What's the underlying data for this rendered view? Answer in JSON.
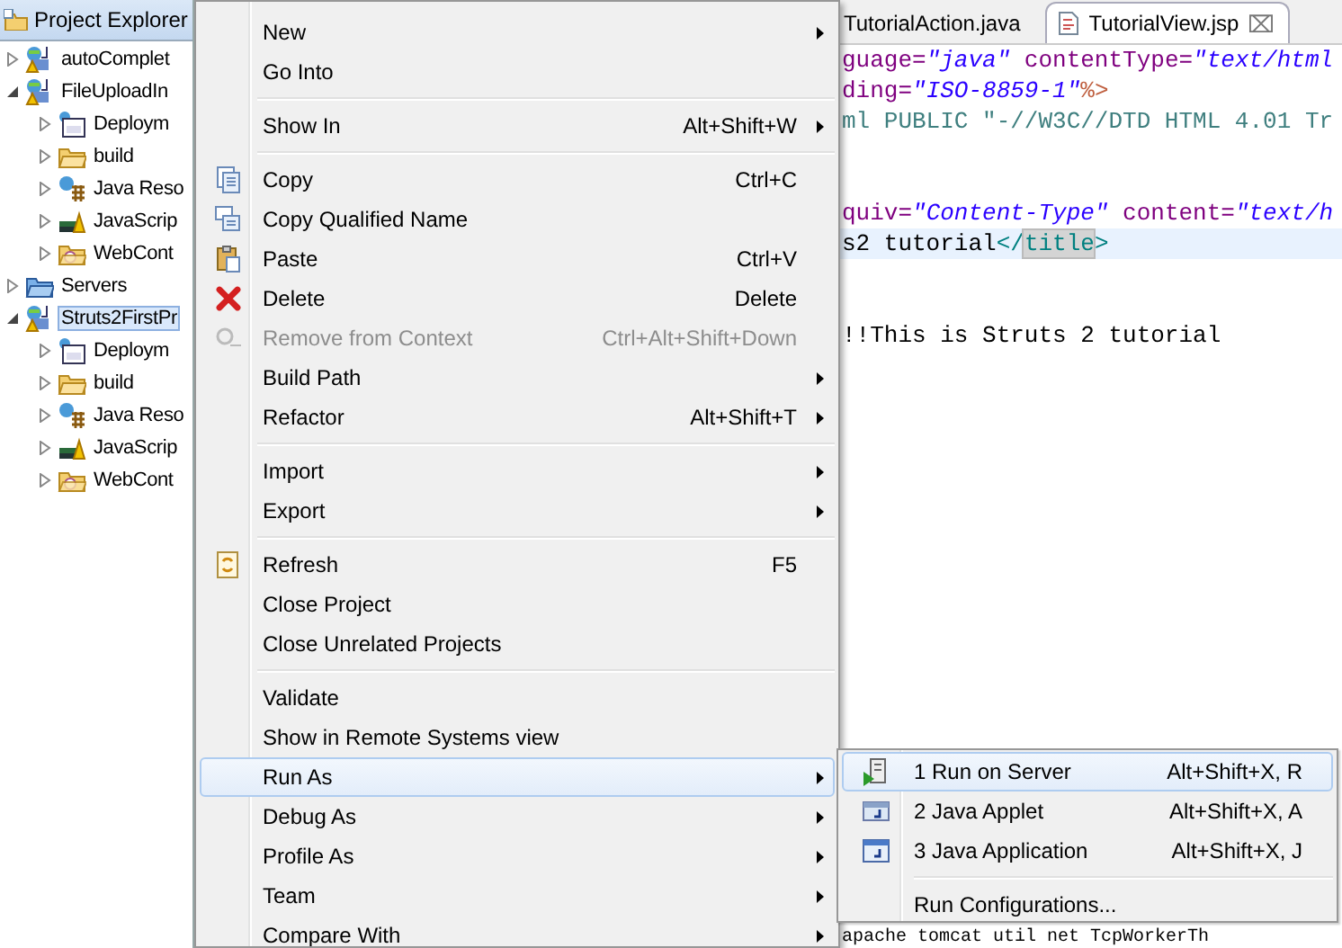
{
  "explorer": {
    "title": "Project Explorer",
    "tree": [
      {
        "label": "autoComplet",
        "expanded": false,
        "selected": false,
        "kind": "project"
      },
      {
        "label": "FileUploadIn",
        "expanded": true,
        "selected": false,
        "kind": "project",
        "children": [
          {
            "label": "Deploym",
            "expanded": false,
            "kind": "descriptor"
          },
          {
            "label": "build",
            "expanded": false,
            "kind": "folder"
          },
          {
            "label": "Java Reso",
            "expanded": false,
            "kind": "resources"
          },
          {
            "label": "JavaScrip",
            "expanded": false,
            "kind": "script"
          },
          {
            "label": "WebCont",
            "expanded": false,
            "kind": "webfolder"
          }
        ]
      },
      {
        "label": "Servers",
        "expanded": false,
        "selected": false,
        "kind": "servers"
      },
      {
        "label": "Struts2FirstPr",
        "expanded": true,
        "selected": true,
        "kind": "project",
        "children": [
          {
            "label": "Deploym",
            "expanded": false,
            "kind": "descriptor"
          },
          {
            "label": "build",
            "expanded": false,
            "kind": "folder"
          },
          {
            "label": "Java Reso",
            "expanded": false,
            "kind": "resources"
          },
          {
            "label": "JavaScrip",
            "expanded": false,
            "kind": "script"
          },
          {
            "label": "WebCont",
            "expanded": false,
            "kind": "webfolder"
          }
        ]
      }
    ]
  },
  "editor": {
    "tabs": [
      {
        "label": "TutorialAction.java",
        "selected": false
      },
      {
        "label": "TutorialView.jsp",
        "selected": true,
        "close": "⌧"
      }
    ],
    "lines": [
      {
        "current": false,
        "segments": [
          {
            "kind": "attr",
            "text": "guage="
          },
          {
            "kind": "string",
            "text": "\"java\""
          },
          {
            "kind": "attr",
            "text": " contentType="
          },
          {
            "kind": "string",
            "text": "\"text/html"
          }
        ]
      },
      {
        "current": false,
        "segments": [
          {
            "kind": "attr",
            "text": "ding="
          },
          {
            "kind": "string",
            "text": "\"ISO-8859-1\""
          },
          {
            "kind": "directive",
            "text": "%>"
          }
        ]
      },
      {
        "current": false,
        "segments": [
          {
            "kind": "doctype",
            "text": "ml PUBLIC \"-//W3C//DTD HTML 4.01 Tr"
          }
        ]
      },
      {
        "current": false
      },
      {
        "current": false
      },
      {
        "current": false,
        "segments": [
          {
            "kind": "attr",
            "text": "quiv="
          },
          {
            "kind": "string",
            "text": "\"Content-Type\""
          },
          {
            "kind": "attr",
            "text": " content="
          },
          {
            "kind": "string",
            "text": "\"text/h"
          }
        ]
      },
      {
        "current": true,
        "segments": [
          {
            "kind": "plain",
            "text": "s2 tutorial"
          },
          {
            "kind": "tag",
            "text": "</"
          },
          {
            "kind": "match",
            "text": "title"
          },
          {
            "kind": "tag",
            "text": ">"
          }
        ]
      },
      {
        "current": false
      },
      {
        "current": false
      },
      {
        "current": false,
        "segments": [
          {
            "kind": "plain",
            "text": "!!This is Struts 2 tutorial"
          }
        ]
      }
    ],
    "console_line": "apache tomcat util net TcpWorkerTh"
  },
  "context_menu": [
    {
      "kind": "item",
      "label": "New",
      "submenu": true
    },
    {
      "kind": "item",
      "label": "Go Into"
    },
    {
      "kind": "separator"
    },
    {
      "kind": "item",
      "label": "Show In",
      "shortcut": "Alt+Shift+W",
      "submenu": true
    },
    {
      "kind": "separator"
    },
    {
      "kind": "item",
      "label": "Copy",
      "shortcut": "Ctrl+C"
    },
    {
      "kind": "item",
      "label": "Copy Qualified Name"
    },
    {
      "kind": "item",
      "label": "Paste",
      "shortcut": "Ctrl+V"
    },
    {
      "kind": "item",
      "label": "Delete",
      "shortcut": "Delete"
    },
    {
      "kind": "item",
      "label": "Remove from Context",
      "shortcut": "Ctrl+Alt+Shift+Down",
      "disabled": true
    },
    {
      "kind": "item",
      "label": "Build Path",
      "submenu": true
    },
    {
      "kind": "item",
      "label": "Refactor",
      "shortcut": "Alt+Shift+T",
      "submenu": true
    },
    {
      "kind": "separator"
    },
    {
      "kind": "item",
      "label": "Import",
      "submenu": true
    },
    {
      "kind": "item",
      "label": "Export",
      "submenu": true
    },
    {
      "kind": "separator"
    },
    {
      "kind": "item",
      "label": "Refresh",
      "shortcut": "F5"
    },
    {
      "kind": "item",
      "label": "Close Project"
    },
    {
      "kind": "item",
      "label": "Close Unrelated Projects"
    },
    {
      "kind": "separator"
    },
    {
      "kind": "item",
      "label": "Validate"
    },
    {
      "kind": "item",
      "label": "Show in Remote Systems view"
    },
    {
      "kind": "item",
      "label": "Run As",
      "submenu": true,
      "selected": true
    },
    {
      "kind": "item",
      "label": "Debug As",
      "submenu": true
    },
    {
      "kind": "item",
      "label": "Profile As",
      "submenu": true
    },
    {
      "kind": "item",
      "label": "Team",
      "submenu": true
    },
    {
      "kind": "item",
      "label": "Compare With",
      "submenu": true
    }
  ],
  "submenu": [
    {
      "kind": "item",
      "label": "1 Run on Server",
      "shortcut": "Alt+Shift+X, R",
      "selected": true
    },
    {
      "kind": "item",
      "label": "2 Java Applet",
      "shortcut": "Alt+Shift+X, A",
      "selected": false
    },
    {
      "kind": "item",
      "label": "3 Java Application",
      "shortcut": "Alt+Shift+X, J",
      "selected": false
    },
    {
      "kind": "separator"
    },
    {
      "kind": "item",
      "label": "Run Configurations...",
      "selected": false
    }
  ]
}
